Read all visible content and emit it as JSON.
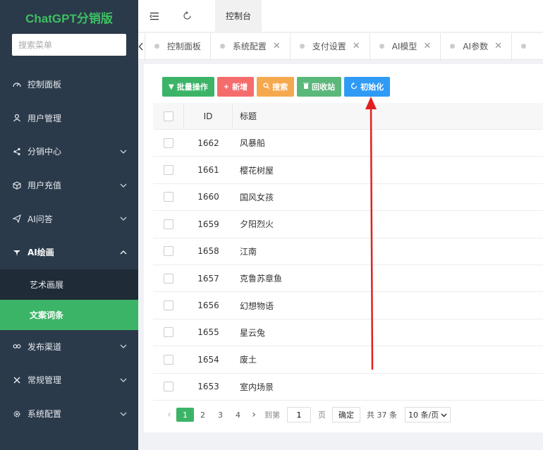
{
  "app": {
    "brand": "ChatGPT分销版"
  },
  "sidebar": {
    "search_placeholder": "搜索菜单",
    "items": [
      {
        "label": "控制面板",
        "icon": "dashboard-icon"
      },
      {
        "label": "用户管理",
        "icon": "user-icon"
      },
      {
        "label": "分销中心",
        "icon": "share-icon"
      },
      {
        "label": "用户充值",
        "icon": "cube-icon"
      },
      {
        "label": "AI问答",
        "icon": "send-icon"
      },
      {
        "label": "AI绘画",
        "icon": "brush-icon"
      },
      {
        "label": "发布渠道",
        "icon": "link-icon"
      },
      {
        "label": "常规管理",
        "icon": "tools-icon"
      },
      {
        "label": "系统配置",
        "icon": "gear-icon"
      }
    ],
    "submenu": [
      {
        "label": "艺术画展"
      },
      {
        "label": "文案词条"
      }
    ]
  },
  "topbar": {
    "tab": "控制台"
  },
  "tabs": [
    {
      "label": "控制面板"
    },
    {
      "label": "系统配置"
    },
    {
      "label": "支付设置"
    },
    {
      "label": "AI模型"
    },
    {
      "label": "AI参数"
    }
  ],
  "toolbar": {
    "batch": "批量操作",
    "add": "新增",
    "search": "搜索",
    "recycle": "回收站",
    "init": "初始化"
  },
  "table": {
    "headers": {
      "id": "ID",
      "title": "标题"
    },
    "rows": [
      {
        "id": "1662",
        "title": "风暴船"
      },
      {
        "id": "1661",
        "title": "樱花树屋"
      },
      {
        "id": "1660",
        "title": "国风女孩"
      },
      {
        "id": "1659",
        "title": "夕阳烈火"
      },
      {
        "id": "1658",
        "title": "江南"
      },
      {
        "id": "1657",
        "title": "克鲁苏章鱼"
      },
      {
        "id": "1656",
        "title": "幻想物语"
      },
      {
        "id": "1655",
        "title": "星云兔"
      },
      {
        "id": "1654",
        "title": "废土"
      },
      {
        "id": "1653",
        "title": "室内场景"
      }
    ]
  },
  "pager": {
    "pages": [
      "1",
      "2",
      "3",
      "4"
    ],
    "goto": "到第",
    "page_value": "1",
    "page_unit": "页",
    "confirm": "确定",
    "total": "共 37 条",
    "per_page": "10 条/页"
  },
  "colors": {
    "accent": "#3cb468",
    "annotation": "#e02020"
  }
}
